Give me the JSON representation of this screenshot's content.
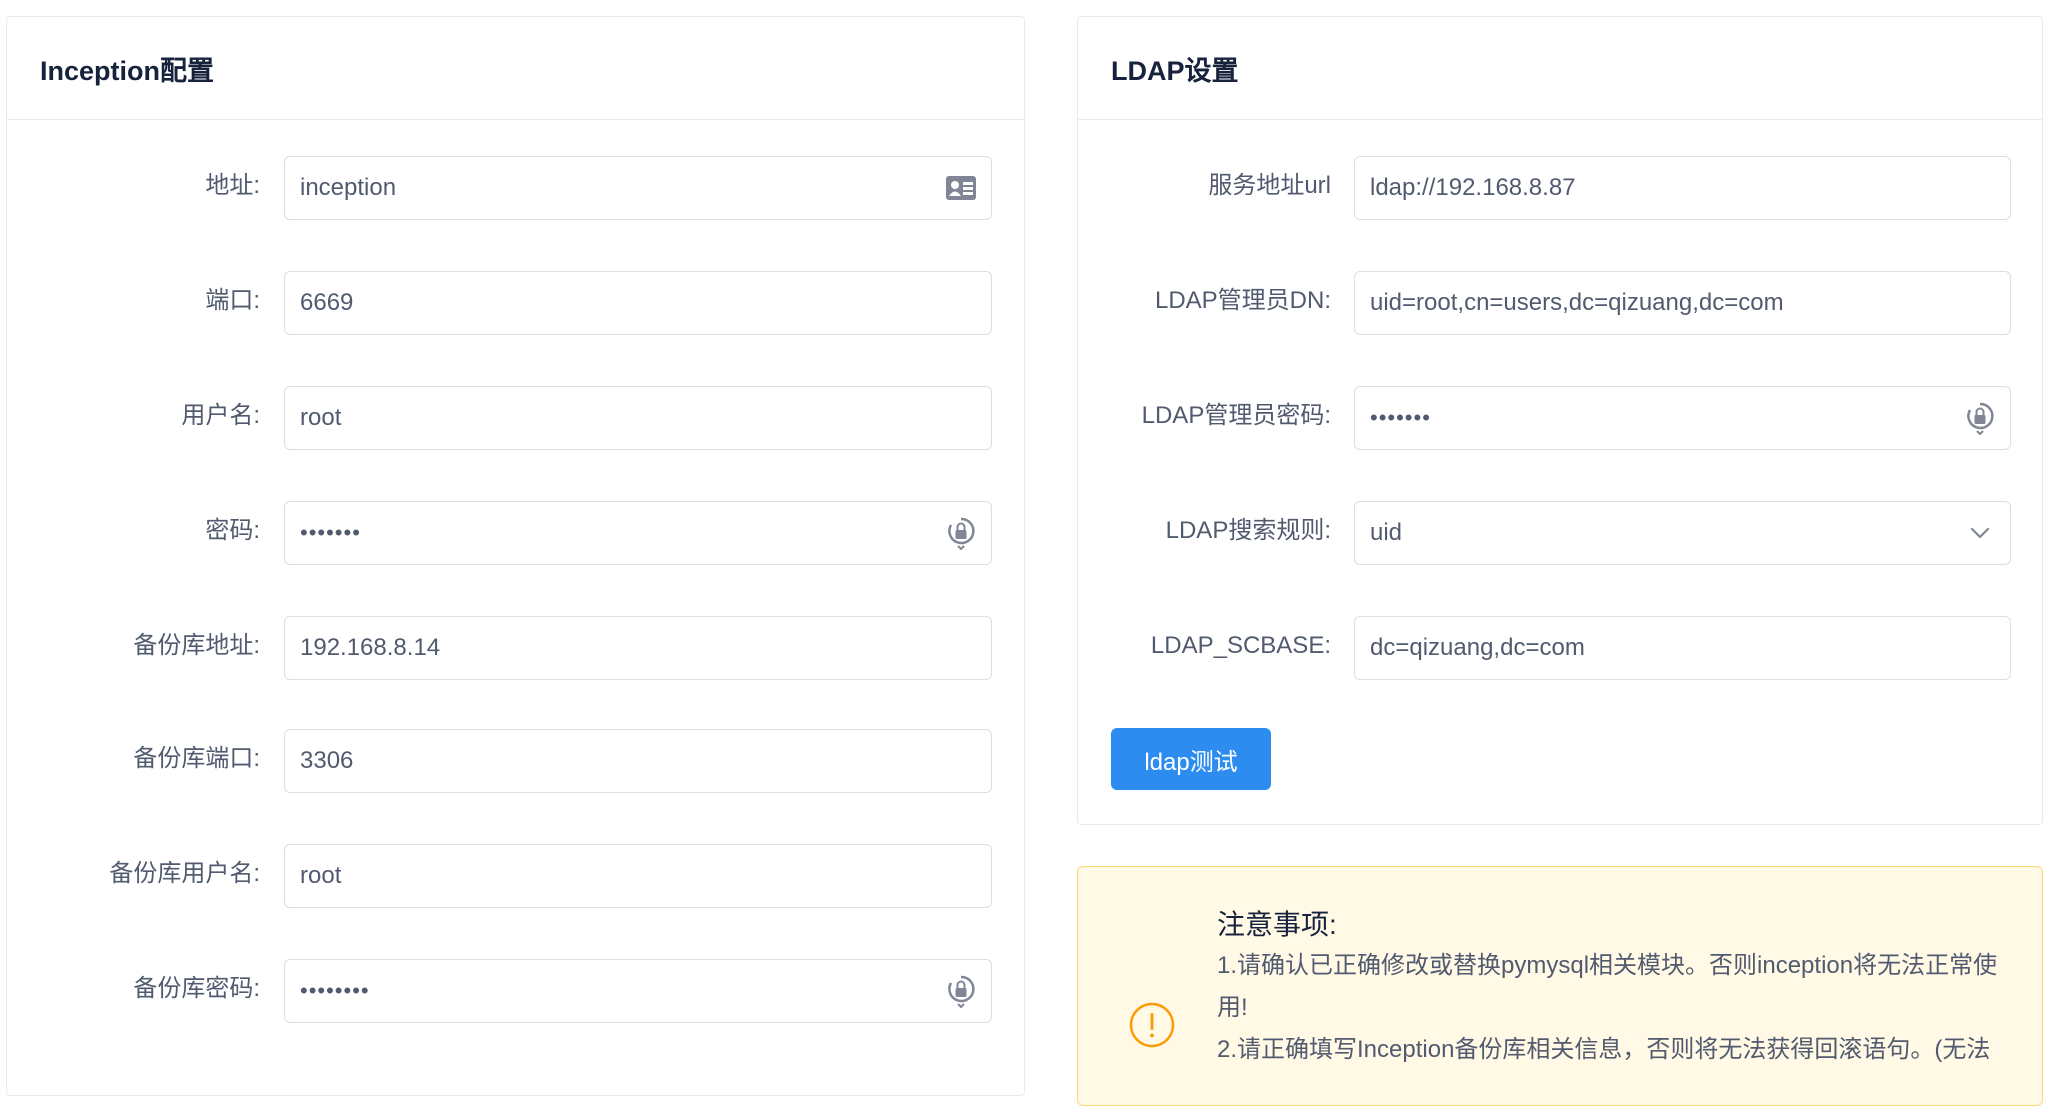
{
  "inception": {
    "title": "Inception配置",
    "fields": [
      {
        "label": "地址:",
        "value": "inception",
        "suffix_icon": "id-card-icon"
      },
      {
        "label": "端口:",
        "value": "6669"
      },
      {
        "label": "用户名:",
        "value": "root"
      },
      {
        "label": "密码:",
        "value": "•••••••",
        "suffix_icon": "password-lock-icon"
      },
      {
        "label": "备份库地址:",
        "value": "192.168.8.14"
      },
      {
        "label": "备份库端口:",
        "value": "3306"
      },
      {
        "label": "备份库用户名:",
        "value": "root"
      },
      {
        "label": "备份库密码:",
        "value": "••••••••",
        "suffix_icon": "password-lock-icon"
      }
    ]
  },
  "ldap": {
    "title": "LDAP设置",
    "fields": [
      {
        "label": "服务地址url",
        "value": "ldap://192.168.8.87"
      },
      {
        "label": "LDAP管理员DN:",
        "value": "uid=root,cn=users,dc=qizuang,dc=com"
      },
      {
        "label": "LDAP管理员密码:",
        "value": "•••••••",
        "suffix_icon": "password-lock-icon"
      },
      {
        "label": "LDAP搜索规则:",
        "value": "uid",
        "suffix_icon": "chevron-down-icon"
      },
      {
        "label": "LDAP_SCBASE:",
        "value": "dc=qizuang,dc=com"
      }
    ],
    "test_button": "ldap测试"
  },
  "notice": {
    "title": "注意事项:",
    "lines": [
      "1.请确认已正确修改或替换pymysql相关模块。否则inception将无法正常使用!",
      "2.请正确填写Inception备份库相关信息，否则将无法获得回滚语句。(无法"
    ],
    "icon": "warning-circle-icon"
  },
  "colors": {
    "primary": "#2d8cf0",
    "warning_bg": "#fff9e6",
    "warning_border": "#ffd77a",
    "warning_icon": "#ff9900",
    "border": "#dcdee2",
    "title": "#17233d",
    "text": "#515a6e"
  }
}
